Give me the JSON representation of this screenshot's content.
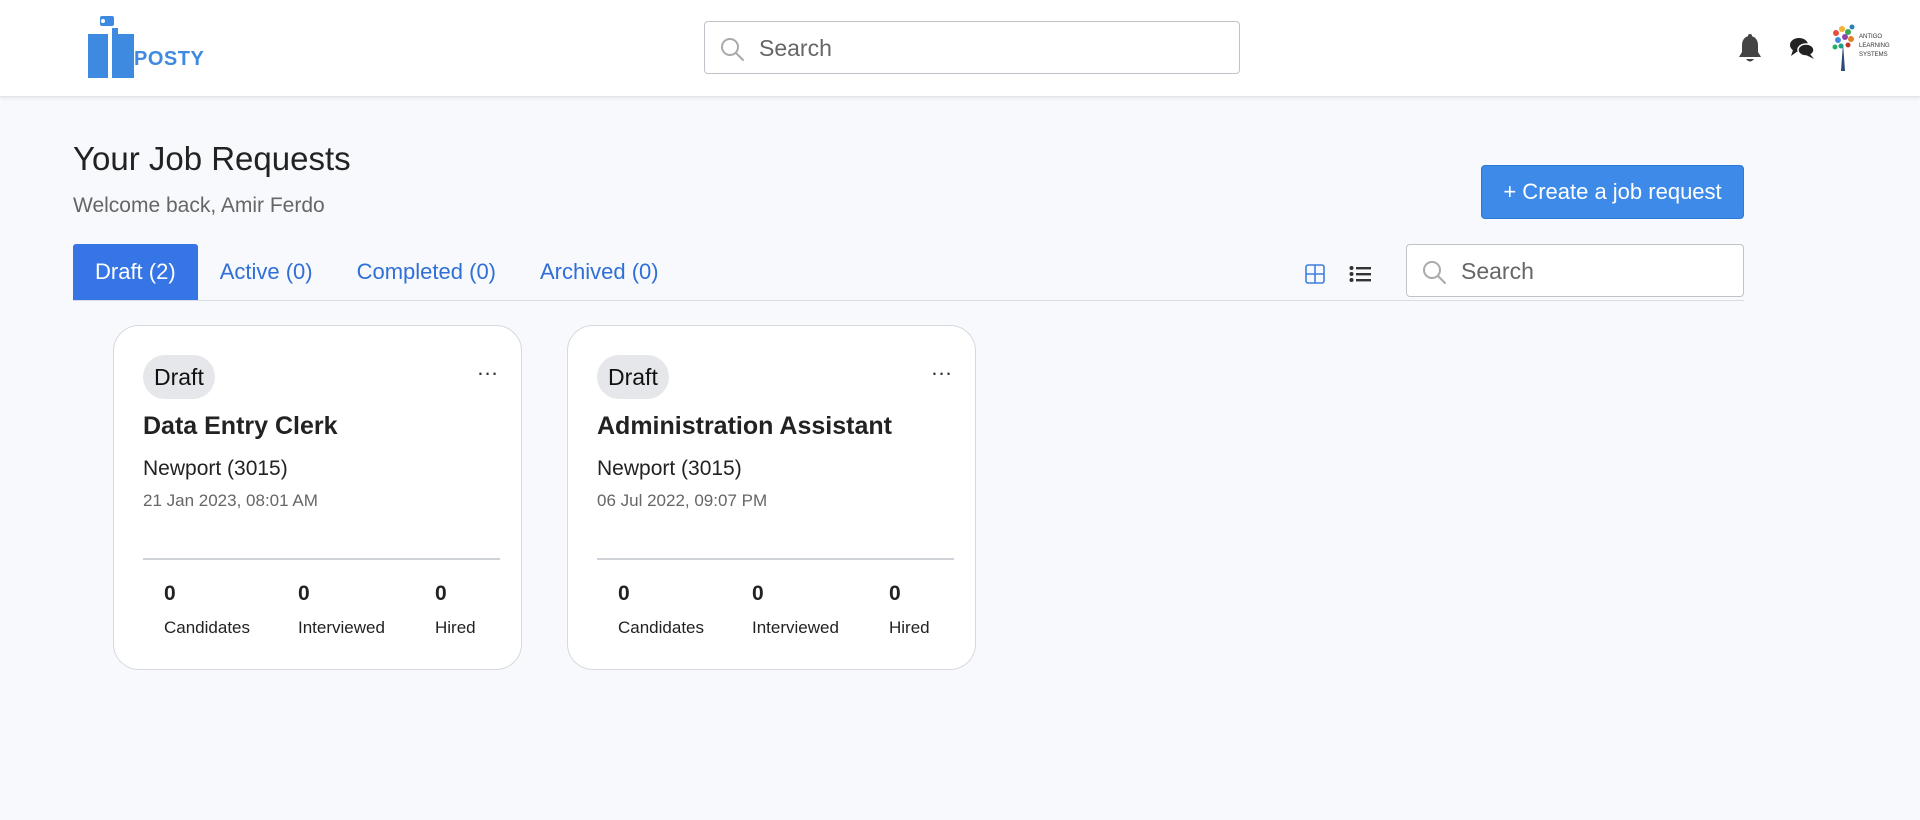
{
  "header": {
    "logo_text": "POSTY",
    "search_placeholder": "Search",
    "brand_logo_text": "ANTIGO LEARNING SYSTEMS"
  },
  "main": {
    "title": "Your Job Requests",
    "welcome": "Welcome back, Amir Ferdo",
    "create_button": "+ Create a job request",
    "filter_search_placeholder": "Search",
    "tabs": [
      {
        "label": "Draft (2)",
        "active": true
      },
      {
        "label": "Active (0)",
        "active": false
      },
      {
        "label": "Completed (0)",
        "active": false
      },
      {
        "label": "Archived (0)",
        "active": false
      }
    ]
  },
  "jobs": [
    {
      "status": "Draft",
      "more": "...",
      "title": "Data Entry Clerk",
      "location": "Newport (3015)",
      "date": "21 Jan 2023, 08:01 AM",
      "stats": [
        {
          "value": "0",
          "label": "Candidates"
        },
        {
          "value": "0",
          "label": "Interviewed"
        },
        {
          "value": "0",
          "label": "Hired"
        }
      ]
    },
    {
      "status": "Draft",
      "more": "...",
      "title": "Administration Assistant",
      "location": "Newport (3015)",
      "date": "06 Jul 2022, 09:07 PM",
      "stats": [
        {
          "value": "0",
          "label": "Candidates"
        },
        {
          "value": "0",
          "label": "Interviewed"
        },
        {
          "value": "0",
          "label": "Hired"
        }
      ]
    }
  ],
  "colors": {
    "primary": "#3575e6",
    "button": "#3d8ae8",
    "link": "#2f6fd6",
    "background": "#f8f9fc"
  },
  "icons": [
    "posty-logo-icon",
    "search-icon",
    "bell-icon",
    "chat-icon",
    "brand-logo",
    "grid-view-icon",
    "list-view-icon"
  ]
}
